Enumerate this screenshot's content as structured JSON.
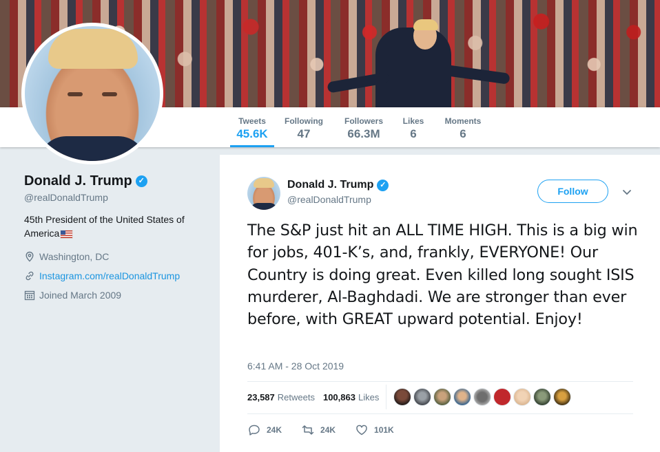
{
  "profile_nav": {
    "items": [
      {
        "label": "Tweets",
        "value": "45.6K",
        "active": true
      },
      {
        "label": "Following",
        "value": "47"
      },
      {
        "label": "Followers",
        "value": "66.3M"
      },
      {
        "label": "Likes",
        "value": "6"
      },
      {
        "label": "Moments",
        "value": "6"
      }
    ]
  },
  "profile": {
    "name": "Donald J. Trump",
    "verified_icon": "verified-badge-icon",
    "handle": "@realDonaldTrump",
    "bio": "45th President of the United States of America",
    "bio_flag": "us-flag-emoji",
    "location": "Washington, DC",
    "location_icon": "location-pin-icon",
    "website": "Instagram.com/realDonaldTrump",
    "website_icon": "link-icon",
    "joined": "Joined March 2009",
    "joined_icon": "calendar-icon"
  },
  "tweet": {
    "author_name": "Donald J. Trump",
    "author_handle": "@realDonaldTrump",
    "follow_label": "Follow",
    "text": "The S&P just hit an ALL TIME HIGH. This is a big win for jobs, 401-K’s, and, frankly, EVERYONE! Our Country is doing great. Even killed long sought ISIS murderer, Al-Baghdadi. We are stronger than ever before, with GREAT upward potential. Enjoy!",
    "timestamp": "6:41 AM - 28 Oct 2019",
    "retweets_count": "23,587",
    "retweets_label": "Retweets",
    "likes_count": "100,863",
    "likes_label": "Likes",
    "reply_count": "24K",
    "retweet_action_count": "24K",
    "like_action_count": "101K"
  },
  "colors": {
    "accent": "#1da1f2",
    "secondary_text": "#657786",
    "primary_text": "#14171a",
    "page_bg": "#e6ecf0"
  }
}
